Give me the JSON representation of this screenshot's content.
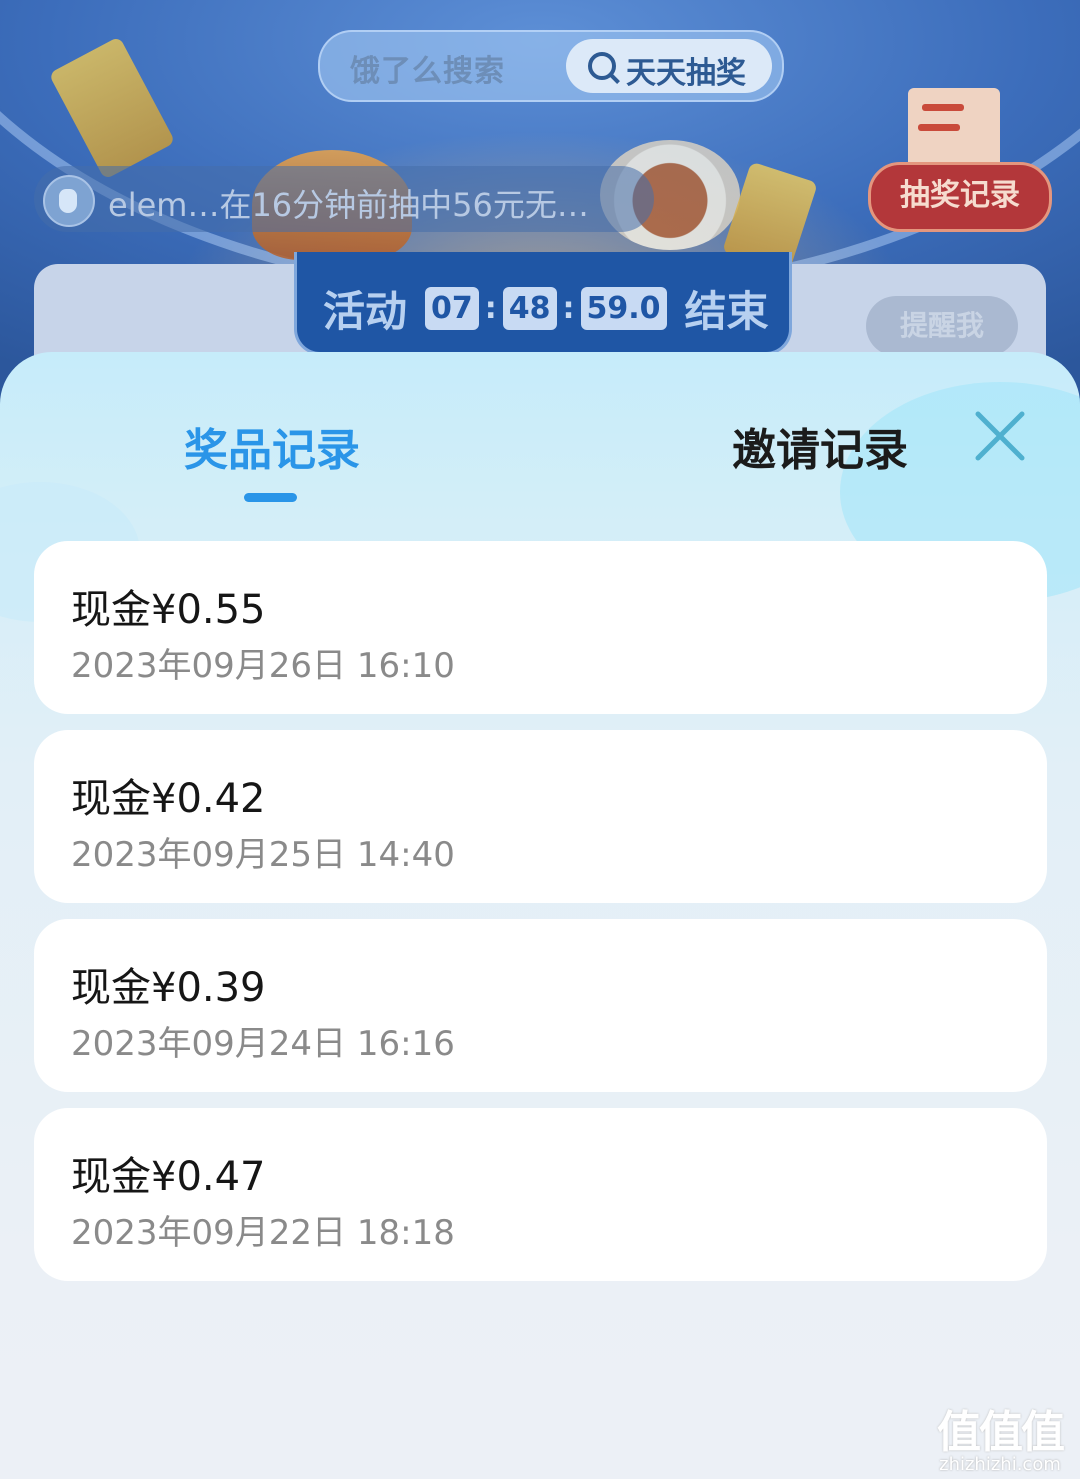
{
  "background": {
    "search": {
      "brand": "饿了么搜索",
      "button_label": "天天抽奖"
    },
    "ticker": {
      "text": "elem…在16分钟前抽中56元无…"
    },
    "records_button": "抽奖记录",
    "timer": {
      "prefix": "活动",
      "hours": "07",
      "minutes": "48",
      "seconds": "59.0",
      "suffix": "结束"
    },
    "remind_button": "提醒我"
  },
  "sheet": {
    "tabs": [
      {
        "label": "奖品记录",
        "active": true
      },
      {
        "label": "邀请记录",
        "active": false
      }
    ],
    "records": [
      {
        "title": "现金¥0.55",
        "date": "2023年09月26日 16:10"
      },
      {
        "title": "现金¥0.42",
        "date": "2023年09月25日 14:40"
      },
      {
        "title": "现金¥0.39",
        "date": "2023年09月24日 16:16"
      },
      {
        "title": "现金¥0.47",
        "date": "2023年09月22日 18:18"
      }
    ]
  },
  "watermark": {
    "glyphs": "值值值",
    "domain": "zhizhizhi.com"
  },
  "colors": {
    "accent": "#2a95e8",
    "card": "#ffffff",
    "date_text": "#8a8a8a"
  }
}
